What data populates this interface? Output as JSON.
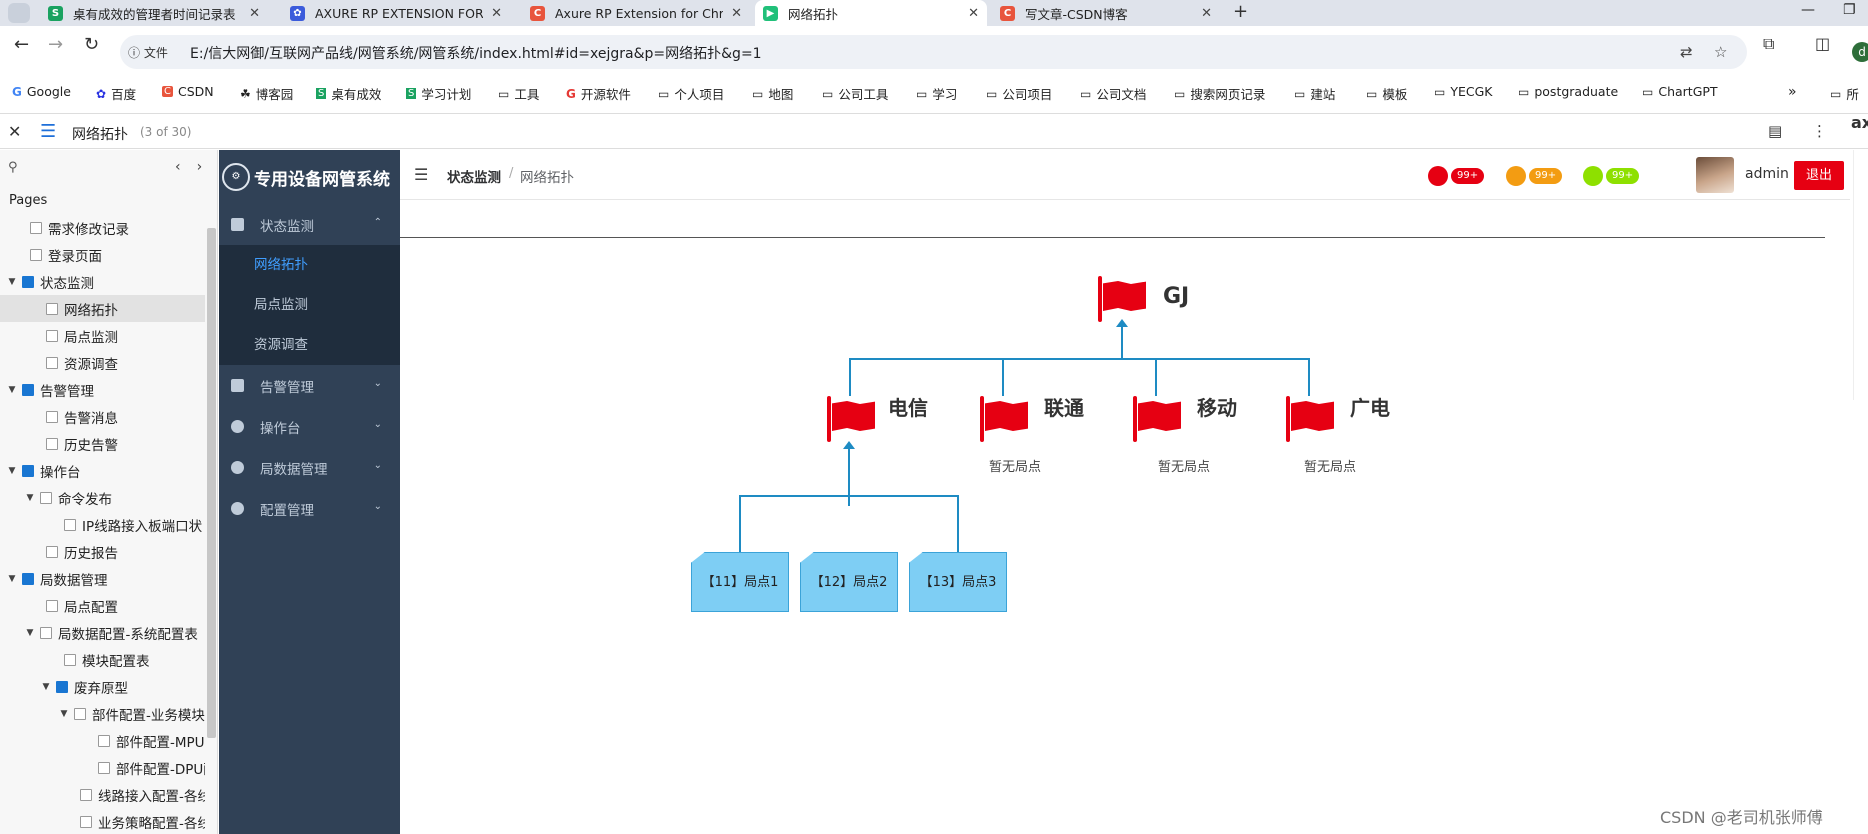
{
  "browser": {
    "tab_menu_icon": "chevron-down-icon",
    "tabs": [
      {
        "title": "桌有成效的管理者时间记录表",
        "fav_color": "#1aa260",
        "fav_text": "S"
      },
      {
        "title": "AXURE RP EXTENSION FOR C",
        "fav_color": "#3b5bdb",
        "fav_text": "✿"
      },
      {
        "title": "Axure RP Extension for Chro",
        "fav_color": "#e8553d",
        "fav_text": "C"
      },
      {
        "title": "网络拓扑",
        "fav_color": "#21c07a",
        "fav_text": "▶"
      },
      {
        "title": "写文章-CSDN博客",
        "fav_color": "#e8553d",
        "fav_text": "C"
      }
    ],
    "active_tab_index": 3,
    "new_tab": "+",
    "win_minimize": "—",
    "win_restore": "❐",
    "info_label": "ⓘ 文件",
    "url": "E:/信大网御/互联网产品线/网管系统/网管系统/index.html#id=xejgra&p=网络拓扑&g=1",
    "profile_initial": "d",
    "bookmarks": [
      {
        "label": "Google",
        "icon": "G",
        "color": "#4285f4"
      },
      {
        "label": "百度",
        "icon": "✿",
        "color": "#2932e1"
      },
      {
        "label": "CSDN",
        "icon": "C",
        "color": "#e8553d"
      },
      {
        "label": "博客园",
        "icon": "☘",
        "color": "#333333"
      },
      {
        "label": "桌有成效",
        "icon": "S",
        "color": "#1aa260"
      },
      {
        "label": "学习计划",
        "icon": "S",
        "color": "#1aa260"
      },
      {
        "label": "工具",
        "icon": "▭",
        "color": "#555555"
      },
      {
        "label": "开源软件",
        "icon": "G",
        "color": "#e53935"
      },
      {
        "label": "个人项目",
        "icon": "▭",
        "color": "#555555"
      },
      {
        "label": "地图",
        "icon": "▭",
        "color": "#555555"
      },
      {
        "label": "公司工具",
        "icon": "▭",
        "color": "#555555"
      },
      {
        "label": "学习",
        "icon": "▭",
        "color": "#555555"
      },
      {
        "label": "公司项目",
        "icon": "▭",
        "color": "#555555"
      },
      {
        "label": "公司文档",
        "icon": "▭",
        "color": "#555555"
      },
      {
        "label": "搜索网页记录",
        "icon": "▭",
        "color": "#555555"
      },
      {
        "label": "建站",
        "icon": "▭",
        "color": "#555555"
      },
      {
        "label": "模板",
        "icon": "▭",
        "color": "#555555"
      },
      {
        "label": "YECGK",
        "icon": "▭",
        "color": "#555555"
      },
      {
        "label": "postgraduate",
        "icon": "▭",
        "color": "#555555"
      },
      {
        "label": "ChartGPT",
        "icon": "▭",
        "color": "#555555"
      }
    ],
    "bookmarks_more": "»",
    "bookmarks_overflow": "所"
  },
  "axure": {
    "page_title": "网络拓扑",
    "page_count": "(3 of 30)",
    "pages_heading": "Pages",
    "right_edge_text": "ax",
    "tree": [
      {
        "label": "需求修改记录",
        "level": 1,
        "type": "page",
        "caret": ""
      },
      {
        "label": "登录页面",
        "level": 1,
        "type": "page",
        "caret": ""
      },
      {
        "label": "状态监测",
        "level": 0,
        "type": "folder",
        "caret": "▼"
      },
      {
        "label": "网络拓扑",
        "level": 2,
        "type": "page",
        "caret": "",
        "selected": true
      },
      {
        "label": "局点监测",
        "level": 2,
        "type": "page",
        "caret": ""
      },
      {
        "label": "资源调查",
        "level": 2,
        "type": "page",
        "caret": ""
      },
      {
        "label": "告警管理",
        "level": 0,
        "type": "folder",
        "caret": "▼"
      },
      {
        "label": "告警消息",
        "level": 2,
        "type": "page",
        "caret": ""
      },
      {
        "label": "历史告警",
        "level": 2,
        "type": "page",
        "caret": ""
      },
      {
        "label": "操作台",
        "level": 0,
        "type": "folder",
        "caret": "▼"
      },
      {
        "label": "命令发布",
        "level": 1,
        "type": "page",
        "caret": "▼"
      },
      {
        "label": "IP线路接入板端口状",
        "level": 3,
        "type": "page",
        "caret": ""
      },
      {
        "label": "历史报告",
        "level": 2,
        "type": "page",
        "caret": ""
      },
      {
        "label": "局数据管理",
        "level": 0,
        "type": "folder",
        "caret": "▼"
      },
      {
        "label": "局点配置",
        "level": 2,
        "type": "page",
        "caret": ""
      },
      {
        "label": "局数据配置-系统配置表",
        "level": 1,
        "type": "page",
        "caret": "▼"
      },
      {
        "label": "模块配置表",
        "level": 3,
        "type": "page",
        "caret": ""
      },
      {
        "label": "废弃原型",
        "level": 2,
        "type": "folder",
        "caret": "▼"
      },
      {
        "label": "部件配置-业务模块",
        "level": 3,
        "type": "page",
        "caret": "▼"
      },
      {
        "label": "部件配置-MPU配",
        "level": 5,
        "type": "page",
        "caret": ""
      },
      {
        "label": "部件配置-DPU配",
        "level": 5,
        "type": "page",
        "caret": ""
      },
      {
        "label": "线路接入配置-各线",
        "level": 4,
        "type": "page",
        "caret": ""
      },
      {
        "label": "业务策略配置-各线",
        "level": 4,
        "type": "page",
        "caret": ""
      }
    ]
  },
  "app": {
    "logo_text": "⚙",
    "title": "专用设备网管系统",
    "menu": [
      {
        "label": "状态监测",
        "icon": "dashboard-icon",
        "chevron": "⌃",
        "expanded": true,
        "children": [
          {
            "label": "网络拓扑",
            "active": true
          },
          {
            "label": "局点监测",
            "active": false
          },
          {
            "label": "资源调查",
            "active": false
          }
        ]
      },
      {
        "label": "告警管理",
        "icon": "alarm-doc-icon",
        "chevron": "⌄",
        "expanded": false
      },
      {
        "label": "操作台",
        "icon": "console-icon",
        "chevron": "⌄",
        "expanded": false
      },
      {
        "label": "局数据管理",
        "icon": "info-icon",
        "chevron": "⌄",
        "expanded": false
      },
      {
        "label": "配置管理",
        "icon": "settings-compass-icon",
        "chevron": "⌄",
        "expanded": false
      }
    ],
    "breadcrumb": {
      "parent": "状态监测",
      "sep": "/",
      "current": "网络拓扑"
    },
    "alarms": [
      {
        "color": "#e60012",
        "count": "99+"
      },
      {
        "color": "#f39c12",
        "count": "99+"
      },
      {
        "color": "#8ee000",
        "count": "99+"
      }
    ],
    "username": "admin",
    "logout_label": "退出"
  },
  "topology": {
    "root": {
      "label": "GJ"
    },
    "carriers": [
      {
        "label": "电信",
        "note": ""
      },
      {
        "label": "联通",
        "note": "暂无局点"
      },
      {
        "label": "移动",
        "note": "暂无局点"
      },
      {
        "label": "广电",
        "note": "暂无局点"
      }
    ],
    "sites": [
      {
        "label": "【11】局点1"
      },
      {
        "label": "【12】局点2"
      },
      {
        "label": "【13】局点3"
      }
    ]
  },
  "watermark": "CSDN @老司机张师傅"
}
